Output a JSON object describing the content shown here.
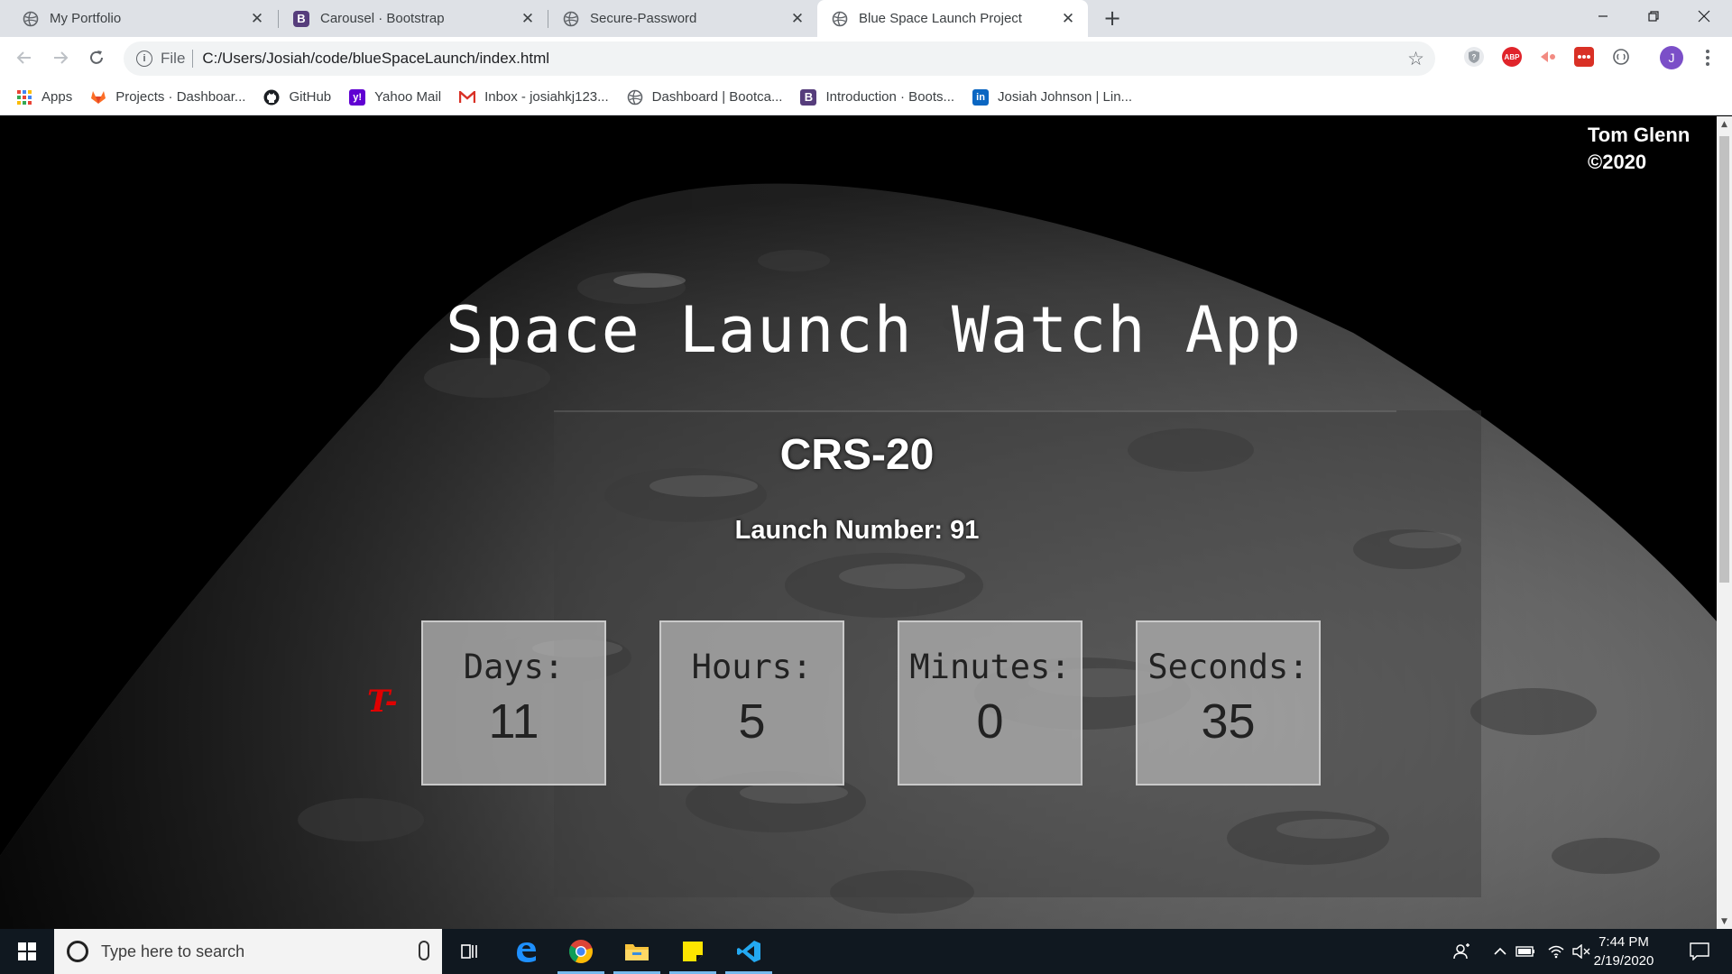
{
  "tabs": [
    {
      "title": "My Portfolio",
      "icon": "globe-icon",
      "active": false
    },
    {
      "title": "Carousel · Bootstrap",
      "icon": "bootstrap-icon",
      "active": false
    },
    {
      "title": "Secure-Password",
      "icon": "globe-icon",
      "active": false
    },
    {
      "title": "Blue Space Launch Project",
      "icon": "globe-icon",
      "active": true
    }
  ],
  "address": {
    "scheme": "File",
    "url": "C:/Users/Josiah/code/blueSpaceLaunch/index.html"
  },
  "bookmarks": [
    {
      "label": "Apps",
      "icon": "apps-grid-icon"
    },
    {
      "label": "Projects · Dashboar...",
      "icon": "gitlab-icon"
    },
    {
      "label": "GitHub",
      "icon": "github-icon"
    },
    {
      "label": "Yahoo Mail",
      "icon": "yahoo-icon"
    },
    {
      "label": "Inbox - josiahkj123...",
      "icon": "gmail-icon"
    },
    {
      "label": "Dashboard | Bootca...",
      "icon": "globe-icon"
    },
    {
      "label": "Introduction · Boots...",
      "icon": "bootstrap-icon"
    },
    {
      "label": "Josiah Johnson | Lin...",
      "icon": "linkedin-icon"
    }
  ],
  "extensions": {
    "abp": "ABP",
    "profile_initial": "J"
  },
  "page": {
    "credit_name": "Tom Glenn",
    "credit_year": "©2020",
    "app_title": "Space Launch Watch App",
    "mission": "CRS-20",
    "launch_number": "Launch Number: 91",
    "t_minus": "T-",
    "countdown": [
      {
        "label": "Days:",
        "value": "11"
      },
      {
        "label": "Hours:",
        "value": "5"
      },
      {
        "label": "Minutes:",
        "value": "0"
      },
      {
        "label": "Seconds:",
        "value": "35"
      }
    ]
  },
  "taskbar": {
    "search_placeholder": "Type here to search",
    "time": "7:44 PM",
    "date": "2/19/2020"
  },
  "colors": {
    "tminus": "#e00000",
    "profile": "#7b4fc8"
  }
}
